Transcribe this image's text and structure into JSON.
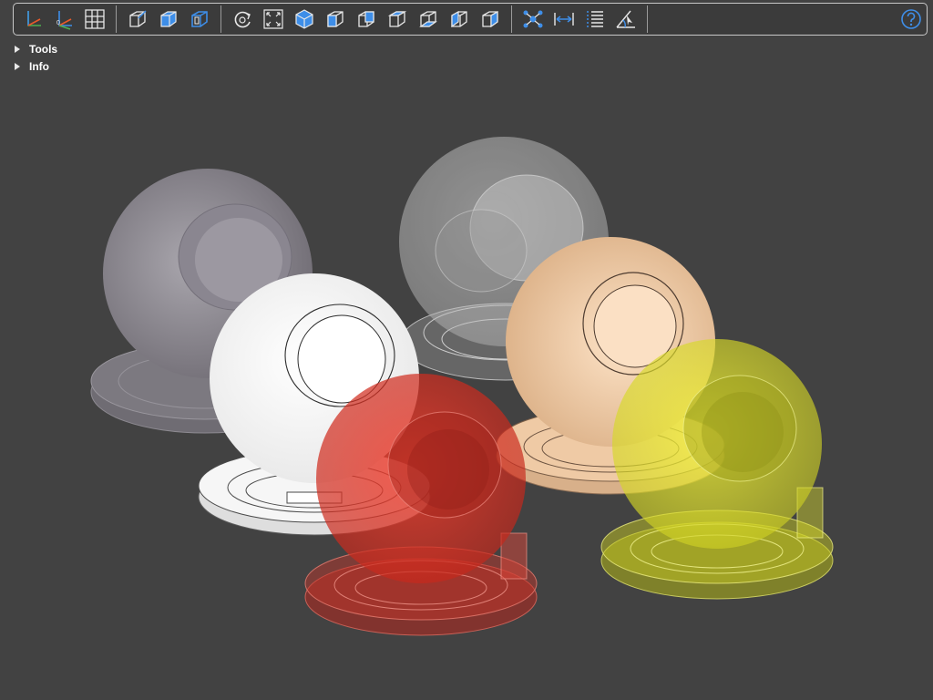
{
  "toolbar": {
    "groups": [
      [
        {
          "name": "axis-gizmo-icon"
        },
        {
          "name": "origin-axis-icon"
        },
        {
          "name": "grid-icon"
        }
      ],
      [
        {
          "name": "wireframe-cube-icon"
        },
        {
          "name": "shaded-cube-icon"
        },
        {
          "name": "shaded-wire-cube-icon"
        }
      ],
      [
        {
          "name": "rotate-icon"
        },
        {
          "name": "fit-view-icon"
        },
        {
          "name": "iso-view-icon"
        },
        {
          "name": "front-view-icon"
        },
        {
          "name": "back-view-icon"
        },
        {
          "name": "top-view-icon"
        },
        {
          "name": "bottom-view-icon"
        },
        {
          "name": "left-view-icon"
        },
        {
          "name": "right-view-icon"
        }
      ],
      [
        {
          "name": "explode-icon"
        },
        {
          "name": "measure-distance-icon"
        },
        {
          "name": "properties-list-icon"
        },
        {
          "name": "measure-angle-icon"
        }
      ]
    ],
    "help": {
      "name": "help-icon"
    }
  },
  "panels": [
    {
      "label": "Tools",
      "expanded": false
    },
    {
      "label": "Info",
      "expanded": false
    }
  ],
  "scene": {
    "objects": [
      {
        "name": "gray-sphere",
        "color": "#8e8a93",
        "opacity": 1.0
      },
      {
        "name": "translucent-white-sphere",
        "color": "#d7d7d7",
        "opacity": 0.45
      },
      {
        "name": "white-sphere",
        "color": "#ffffff",
        "opacity": 1.0
      },
      {
        "name": "peach-sphere",
        "color": "#f1c9a0",
        "opacity": 1.0
      },
      {
        "name": "red-sphere",
        "color": "#e0301f",
        "opacity": 0.6
      },
      {
        "name": "yellow-sphere",
        "color": "#e8ea2a",
        "opacity": 0.6
      }
    ]
  },
  "colors": {
    "background": "#424242",
    "toolbar_border": "#c8c8c8",
    "accent_blue": "#3e8ee8"
  }
}
